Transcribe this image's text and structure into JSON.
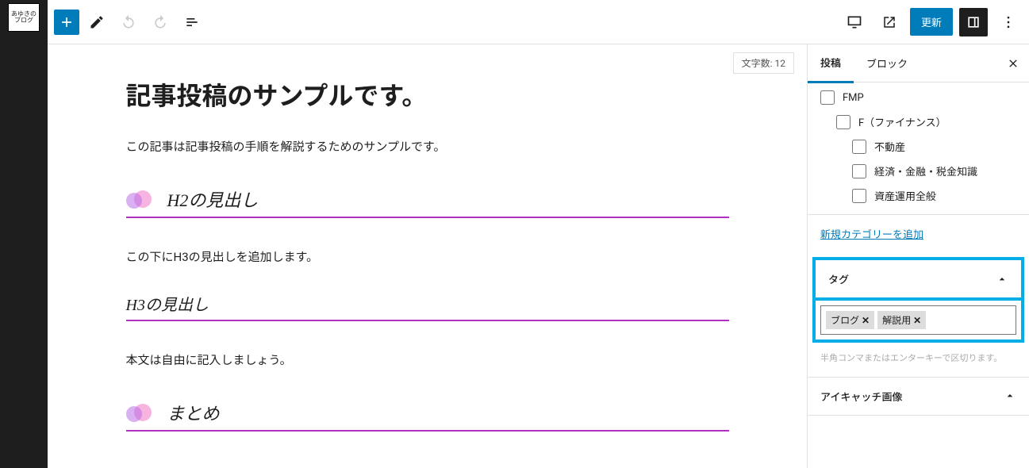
{
  "logo": "あゆきのブログ",
  "topbar": {
    "update_label": "更新"
  },
  "word_count": "文字数: 12",
  "post": {
    "title": "記事投稿のサンプルです。",
    "intro": "この記事は記事投稿の手順を解説するためのサンプルです。",
    "h2_1": "H2の見出し",
    "p1": "この下にH3の見出しを追加します。",
    "h3_1": "H3の見出し",
    "p2": "本文は自由に記入しましょう。",
    "h2_2": "まとめ"
  },
  "settings": {
    "tab_post": "投稿",
    "tab_block": "ブロック",
    "categories": [
      {
        "label": "FMP",
        "indent": 0
      },
      {
        "label": "F（ファイナンス）",
        "indent": 1
      },
      {
        "label": "不動産",
        "indent": 2
      },
      {
        "label": "経済・金融・税金知識",
        "indent": 2
      },
      {
        "label": "資産運用全般",
        "indent": 2
      }
    ],
    "add_category": "新規カテゴリーを追加",
    "tag_header": "タグ",
    "tags": [
      "ブログ",
      "解説用"
    ],
    "tag_hint": "半角コンマまたはエンターキーで区切ります。",
    "eyecatch_header": "アイキャッチ画像"
  }
}
